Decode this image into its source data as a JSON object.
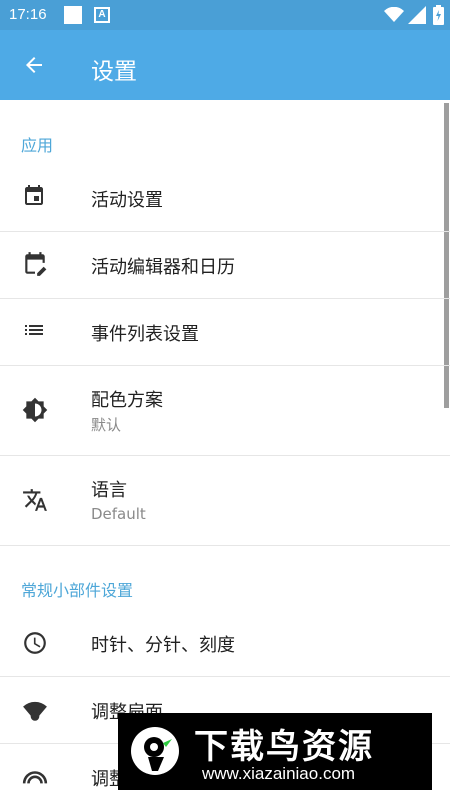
{
  "status_bar": {
    "time": "17:16",
    "badge": "A"
  },
  "app_bar": {
    "title": "设置"
  },
  "sections": [
    {
      "title": "应用"
    },
    {
      "title": "常规小部件设置"
    }
  ],
  "items": [
    {
      "label": "活动设置",
      "icon": "calendar-icon"
    },
    {
      "label": "活动编辑器和日历",
      "icon": "calendar-edit-icon"
    },
    {
      "label": "事件列表设置",
      "icon": "list-icon"
    },
    {
      "label": "配色方案",
      "sub": "默认",
      "icon": "brightness-icon"
    },
    {
      "label": "语言",
      "sub": "Default",
      "icon": "translate-icon"
    },
    {
      "label": "时针、分针、刻度",
      "icon": "clock-icon"
    },
    {
      "label": "调整扁面",
      "icon": "wifi-icon"
    },
    {
      "label": "调整",
      "icon": "arc-icon"
    }
  ],
  "watermark": {
    "main": "下载鸟资源",
    "url": "www.xiazainiao.com"
  },
  "colors": {
    "appbar": "#4eaae6",
    "statusbar": "#4a9fd6",
    "section": "#4ea7d8"
  }
}
